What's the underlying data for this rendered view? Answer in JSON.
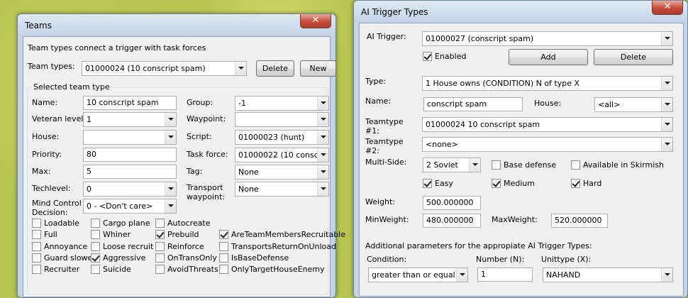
{
  "teams": {
    "title": "Teams",
    "close": "✕",
    "description": "Team types connect a trigger with task forces",
    "team_types_label": "Team types:",
    "team_types_value": "01000024 (10 conscript spam)",
    "delete_label": "Delete",
    "new_label": "New",
    "group_caption": "Selected team type",
    "name_label": "Name:",
    "name_value": "10 conscript spam",
    "veteran_label": "Veteran level:",
    "veteran_value": "1",
    "house_label": "House:",
    "house_value": "",
    "priority_label": "Priority:",
    "priority_value": "80",
    "max_label": "Max:",
    "max_value": "5",
    "techlevel_label": "Techlevel:",
    "techlevel_value": "0",
    "mind_label": "Mind Control Decision:",
    "mind_value": "0 - <Don't care>",
    "group_label": "Group:",
    "group_value": "-1",
    "waypoint_label": "Waypoint:",
    "waypoint_value": "",
    "script_label": "Script:",
    "script_value": "01000023 (hunt)",
    "taskforce_label": "Task force:",
    "taskforce_value": "01000022 (10 conscrip",
    "tag_label": "Tag:",
    "tag_value": "None",
    "transport_label": "Transport waypoint:",
    "transport_value": "None",
    "flags": [
      {
        "label": "Loadable",
        "checked": false
      },
      {
        "label": "Cargo plane",
        "checked": false
      },
      {
        "label": "Autocreate",
        "checked": false
      },
      {
        "label": "Full",
        "checked": false
      },
      {
        "label": "Whiner",
        "checked": false
      },
      {
        "label": "Prebuild",
        "checked": true
      },
      {
        "label": "AreTeamMembersRecruitable",
        "checked": true
      },
      {
        "label": "Annoyance",
        "checked": false
      },
      {
        "label": "Loose recruit",
        "checked": false
      },
      {
        "label": "Reinforce",
        "checked": false
      },
      {
        "label": "TransportsReturnOnUnload",
        "checked": false
      },
      {
        "label": "Guard slower",
        "checked": false
      },
      {
        "label": "Aggressive",
        "checked": true
      },
      {
        "label": "OnTransOnly",
        "checked": false
      },
      {
        "label": "IsBaseDefense",
        "checked": false
      },
      {
        "label": "Recruiter",
        "checked": false
      },
      {
        "label": "Suicide",
        "checked": false
      },
      {
        "label": "AvoidThreats",
        "checked": false
      },
      {
        "label": "OnlyTargetHouseEnemy",
        "checked": false
      }
    ]
  },
  "ai": {
    "title": "AI Trigger Types",
    "close": "✕",
    "trigger_label": "AI Trigger:",
    "trigger_value": "01000027 (conscript spam)",
    "enabled_label": "Enabled",
    "enabled_checked": true,
    "add_label": "Add",
    "delete_label": "Delete",
    "type_label": "Type:",
    "type_value": "1 House owns (CONDITION) N of type X",
    "name_label": "Name:",
    "name_value": "conscript spam",
    "house_label": "House:",
    "house_value": "<all>",
    "teamtype1_label": "Teamtype #1:",
    "teamtype1_value": "01000024 10 conscript spam",
    "teamtype2_label": "Teamtype #2:",
    "teamtype2_value": "<none>",
    "multiside_label": "Multi-Side:",
    "multiside_value": "2 Soviet",
    "base_defense_label": "Base defense",
    "base_defense_checked": false,
    "skirmish_label": "Available in Skirmish",
    "skirmish_checked": false,
    "easy_label": "Easy",
    "easy_checked": true,
    "medium_label": "Medium",
    "medium_checked": true,
    "hard_label": "Hard",
    "hard_checked": true,
    "weight_label": "Weight:",
    "weight_value": "500.000000",
    "minweight_label": "MinWeight:",
    "minweight_value": "480.000000",
    "maxweight_label": "MaxWeight:",
    "maxweight_value": "520.000000",
    "params_caption": "Additional parameters for the appropiate AI Trigger Types:",
    "condition_label": "Condition:",
    "condition_value": "greater than or equal to",
    "number_label": "Number (N):",
    "number_value": "1",
    "unittype_label": "Unittype (X):",
    "unittype_value": "NAHAND"
  }
}
